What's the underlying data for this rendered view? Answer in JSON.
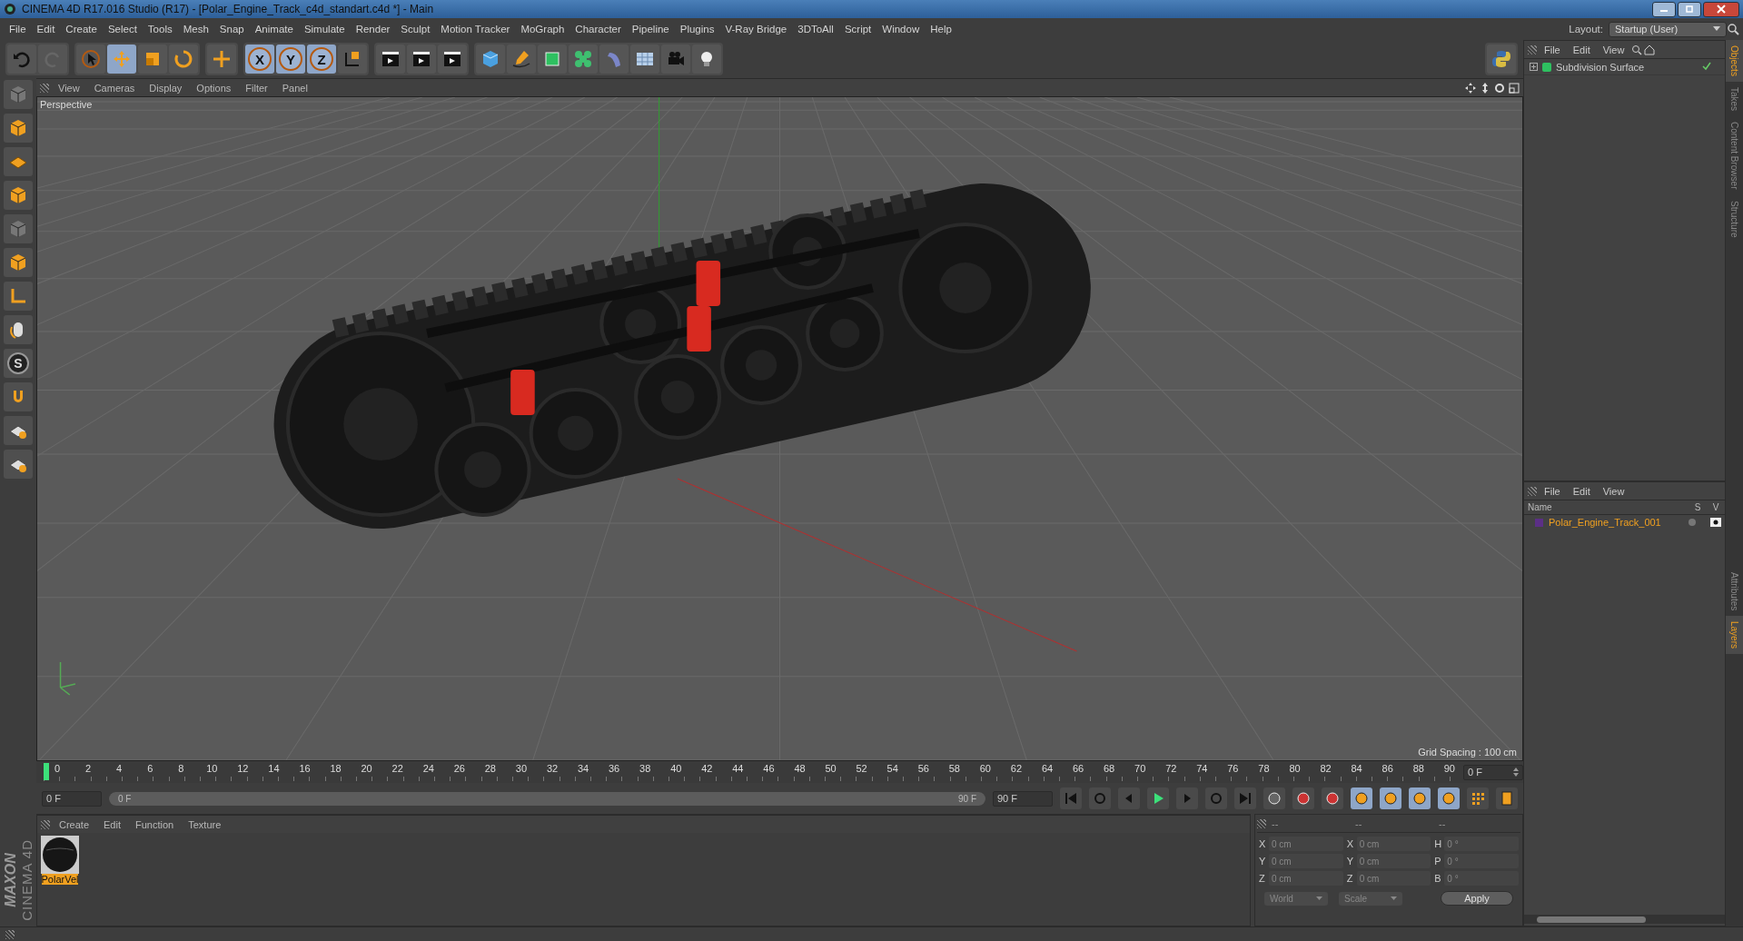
{
  "window": {
    "title": "CINEMA 4D R17.016 Studio (R17) - [Polar_Engine_Track_c4d_standart.c4d *] - Main"
  },
  "menu": [
    "File",
    "Edit",
    "Create",
    "Select",
    "Tools",
    "Mesh",
    "Snap",
    "Animate",
    "Simulate",
    "Render",
    "Sculpt",
    "Motion Tracker",
    "MoGraph",
    "Character",
    "Pipeline",
    "Plugins",
    "V-Ray Bridge",
    "3DToAll",
    "Script",
    "Window",
    "Help"
  ],
  "layout": {
    "label": "Layout:",
    "value": "Startup (User)"
  },
  "axis_buttons": [
    {
      "label": "X",
      "on": true
    },
    {
      "label": "Y",
      "on": true
    },
    {
      "label": "Z",
      "on": true
    }
  ],
  "left_tools": {
    "soft_selection": "S"
  },
  "viewport": {
    "menu": [
      "View",
      "Cameras",
      "Display",
      "Options",
      "Filter",
      "Panel"
    ],
    "camera": "Perspective",
    "grid_spacing": "Grid Spacing : 100 cm"
  },
  "timeline": {
    "ticks": [
      "0",
      "2",
      "4",
      "6",
      "8",
      "10",
      "12",
      "14",
      "16",
      "18",
      "20",
      "22",
      "24",
      "26",
      "28",
      "30",
      "32",
      "34",
      "36",
      "38",
      "40",
      "42",
      "44",
      "46",
      "48",
      "50",
      "52",
      "54",
      "56",
      "58",
      "60",
      "62",
      "64",
      "66",
      "68",
      "70",
      "72",
      "74",
      "76",
      "78",
      "80",
      "82",
      "84",
      "86",
      "88",
      "90"
    ],
    "current_frame": "0 F",
    "start_field": "0 F",
    "range": {
      "start": "0 F",
      "end": "90 F",
      "level": 1
    },
    "end_field": "90 F"
  },
  "materials": {
    "menu": [
      "Create",
      "Edit",
      "Function",
      "Texture"
    ],
    "items": [
      {
        "name": "PolarVel",
        "selected": true
      }
    ]
  },
  "logo": {
    "brand": "MAXON",
    "product": "CINEMA 4D"
  },
  "coordinates": {
    "headers": [
      "--",
      "--",
      "--"
    ],
    "rows": [
      {
        "label": "X",
        "value": "0 cm"
      },
      {
        "label": "X",
        "value": "0 cm"
      },
      {
        "label": "H",
        "value": "0 °"
      },
      {
        "label": "Y",
        "value": "0 cm"
      },
      {
        "label": "Y",
        "value": "0 cm"
      },
      {
        "label": "P",
        "value": "0 °"
      },
      {
        "label": "Z",
        "value": "0 cm"
      },
      {
        "label": "Z",
        "value": "0 cm"
      },
      {
        "label": "B",
        "value": "0 °"
      }
    ],
    "mode": "World",
    "transform": "Scale",
    "apply": "Apply"
  },
  "objects": {
    "menu": [
      "File",
      "Edit",
      "View"
    ],
    "items": [
      {
        "name": "Subdivision Surface"
      }
    ]
  },
  "layers": {
    "menu": [
      "File",
      "Edit",
      "View"
    ],
    "columns": [
      "Name",
      "S",
      "V"
    ],
    "items": [
      {
        "name": "Polar_Engine_Track_001",
        "color": "#5b2f86"
      }
    ]
  },
  "side_tabs_top": [
    {
      "label": "Objects",
      "selected": true
    },
    {
      "label": "Takes",
      "selected": false
    },
    {
      "label": "Content Browser",
      "selected": false
    },
    {
      "label": "Structure",
      "selected": false
    }
  ],
  "side_tabs_bottom": [
    {
      "label": "Attributes",
      "selected": false
    },
    {
      "label": "Layers",
      "selected": true
    }
  ]
}
